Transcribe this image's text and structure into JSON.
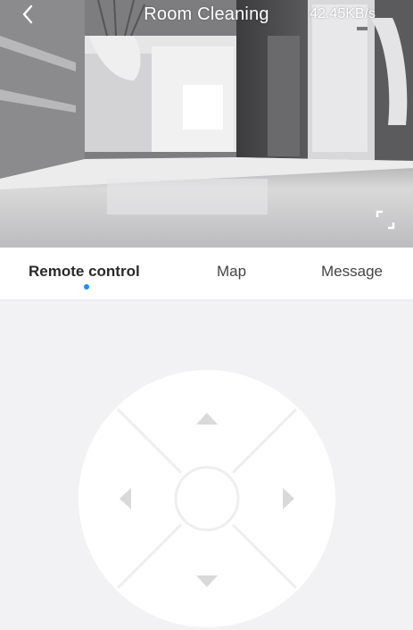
{
  "header": {
    "title": "Room Cleaning",
    "data_rate": "42.45KB/s"
  },
  "icons": {
    "back": "chevron-left-icon",
    "fullscreen": "fullscreen-icon",
    "up": "arrow-up-icon",
    "down": "arrow-down-icon",
    "left": "arrow-left-icon",
    "right": "arrow-right-icon"
  },
  "tabs": [
    {
      "label": "Remote control",
      "active": true
    },
    {
      "label": "Map",
      "active": false
    },
    {
      "label": "Message",
      "active": false
    }
  ],
  "colors": {
    "accent": "#1a8cff",
    "background": "#f2f1f4",
    "pad": "#ffffff",
    "arrow": "#d9d9dc"
  }
}
